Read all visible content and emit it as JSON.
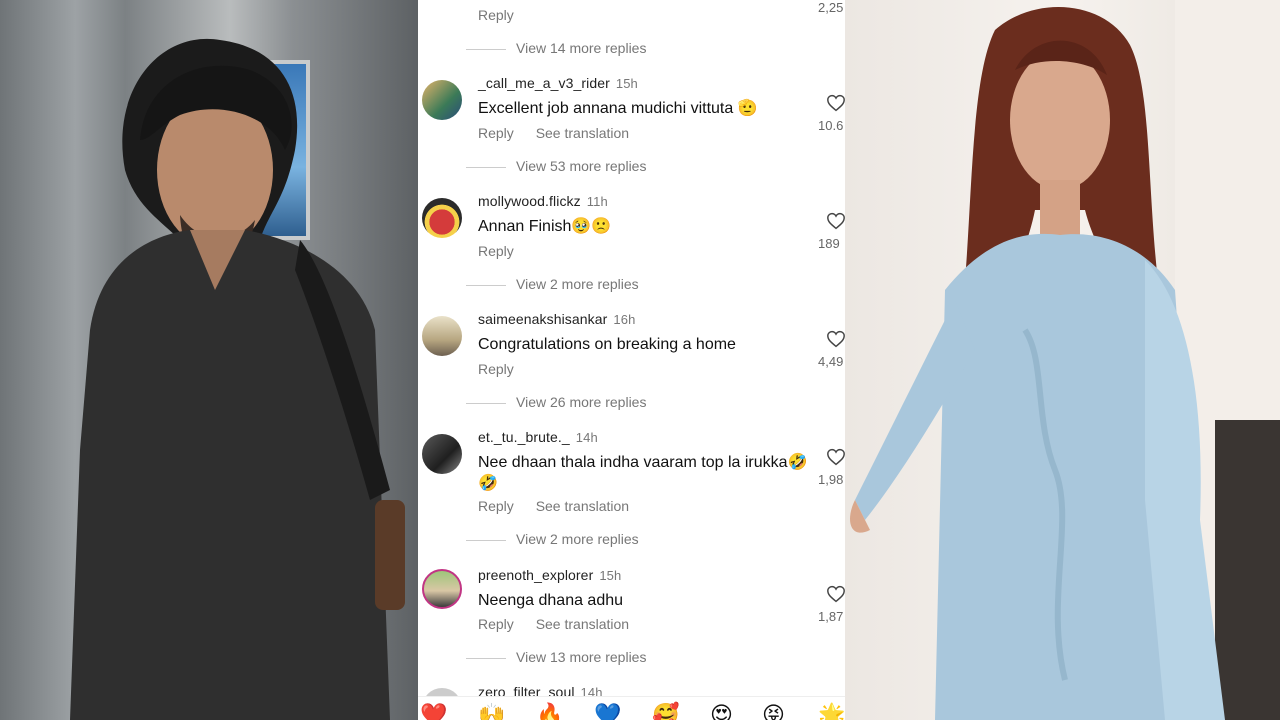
{
  "top_partial": {
    "reply": "Reply",
    "replies": "View 14 more replies",
    "count": "2,25"
  },
  "comments": [
    {
      "username": "_call_me_a_v3_rider",
      "time": "15h",
      "text": "Excellent job annana mudichi vittuta 🫡",
      "reply": "Reply",
      "translation": "See translation",
      "likes": "10.6",
      "replies": "View 53 more replies"
    },
    {
      "username": "mollywood.flickz",
      "time": "11h",
      "text": "Annan Finish🥹🙁",
      "reply": "Reply",
      "translation": "",
      "likes": "189",
      "replies": "View 2 more replies"
    },
    {
      "username": "saimeenakshisankar",
      "time": "16h",
      "text": "Congratulations on breaking a home",
      "reply": "Reply",
      "translation": "",
      "likes": "4,49",
      "replies": "View 26 more replies"
    },
    {
      "username": "et._tu._brute._",
      "time": "14h",
      "text": "Nee dhaan thala indha vaaram top la irukka🤣🤣",
      "reply": "Reply",
      "translation": "See translation",
      "likes": "1,98",
      "replies": "View 2 more replies"
    },
    {
      "username": "preenoth_explorer",
      "time": "15h",
      "text": "Neenga dhana adhu",
      "reply": "Reply",
      "translation": "See translation",
      "likes": "1,87",
      "replies": "View 13 more replies"
    }
  ],
  "bottom_partial": {
    "username": "zero_filter_soul",
    "time": "14h"
  },
  "emoji_bar": [
    "❤️",
    "🙌",
    "🔥",
    "💙",
    "🥰",
    "😍",
    "😝",
    "🌟"
  ],
  "icons": {
    "like": "heart-outline-icon"
  }
}
